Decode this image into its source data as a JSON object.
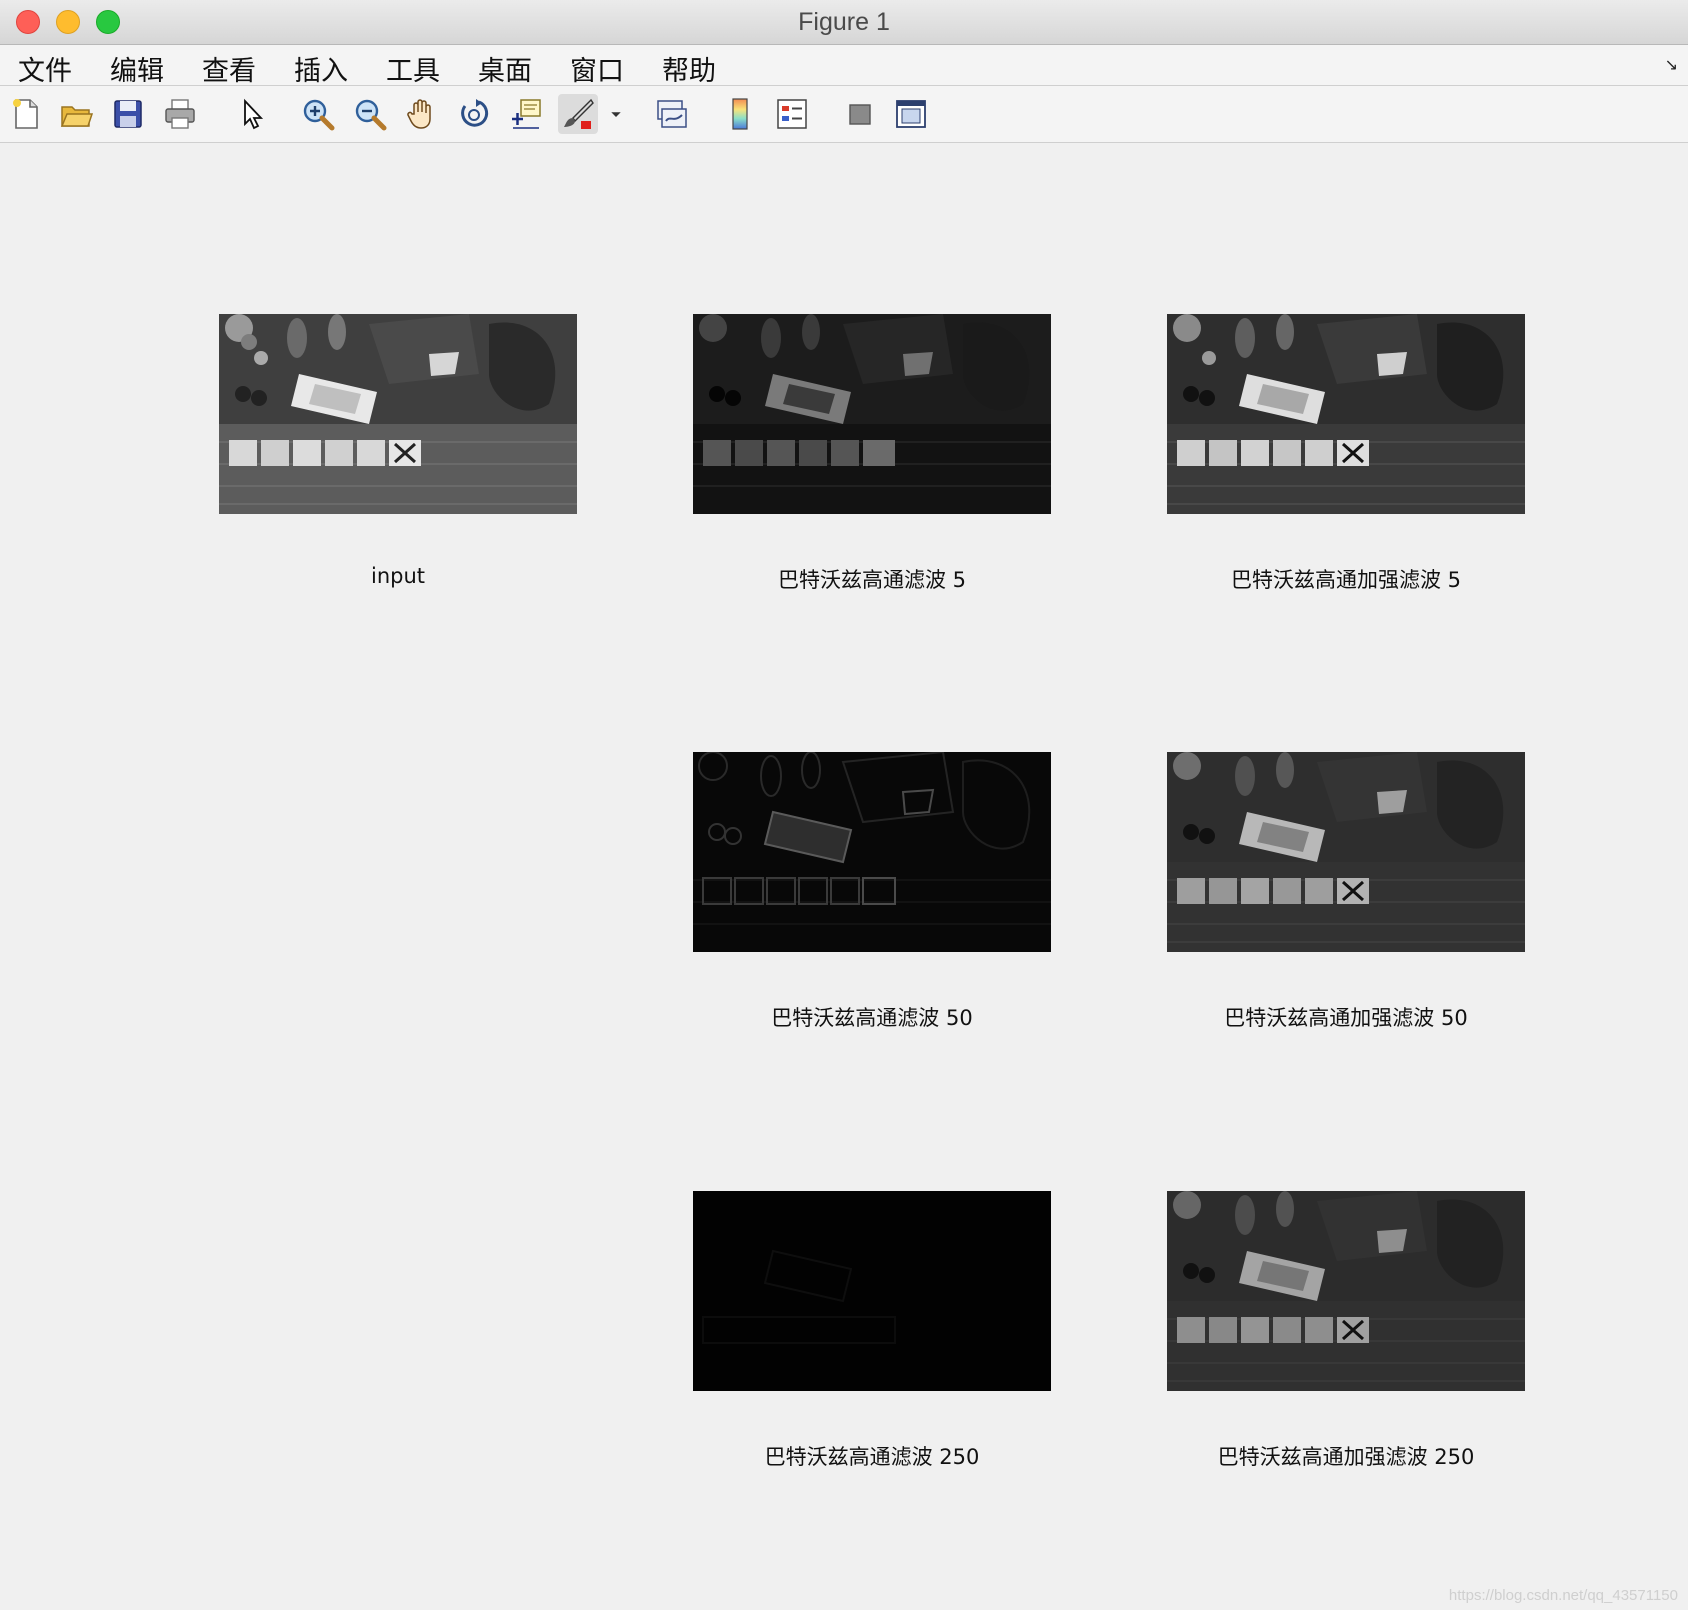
{
  "window": {
    "title": "Figure 1"
  },
  "menu": {
    "items": [
      "文件",
      "编辑",
      "查看",
      "插入",
      "工具",
      "桌面",
      "窗口",
      "帮助"
    ]
  },
  "toolbar": {
    "icons": [
      "new-figure-icon",
      "open-file-icon",
      "save-icon",
      "print-icon",
      "pointer-icon",
      "zoom-in-icon",
      "zoom-out-icon",
      "pan-hand-icon",
      "rotate-3d-icon",
      "data-cursor-icon",
      "brush-icon",
      "brush-dropdown-icon",
      "link-plot-icon",
      "colorbar-icon",
      "legend-icon",
      "hide-plot-tools-icon",
      "show-plot-tools-icon"
    ]
  },
  "subplots": {
    "input": {
      "caption": "input"
    },
    "bh5": {
      "caption": "巴特沃兹高通滤波 5"
    },
    "bhe5": {
      "caption": "巴特沃兹高通加强滤波 5"
    },
    "bh50": {
      "caption": "巴特沃兹高通滤波 50"
    },
    "bhe50": {
      "caption": "巴特沃兹高通加强滤波 50"
    },
    "bh250": {
      "caption": "巴特沃兹高通滤波 250"
    },
    "bhe250": {
      "caption": "巴特沃兹高通加强滤波 250"
    }
  },
  "watermark": "https://blog.csdn.net/qq_43571150"
}
